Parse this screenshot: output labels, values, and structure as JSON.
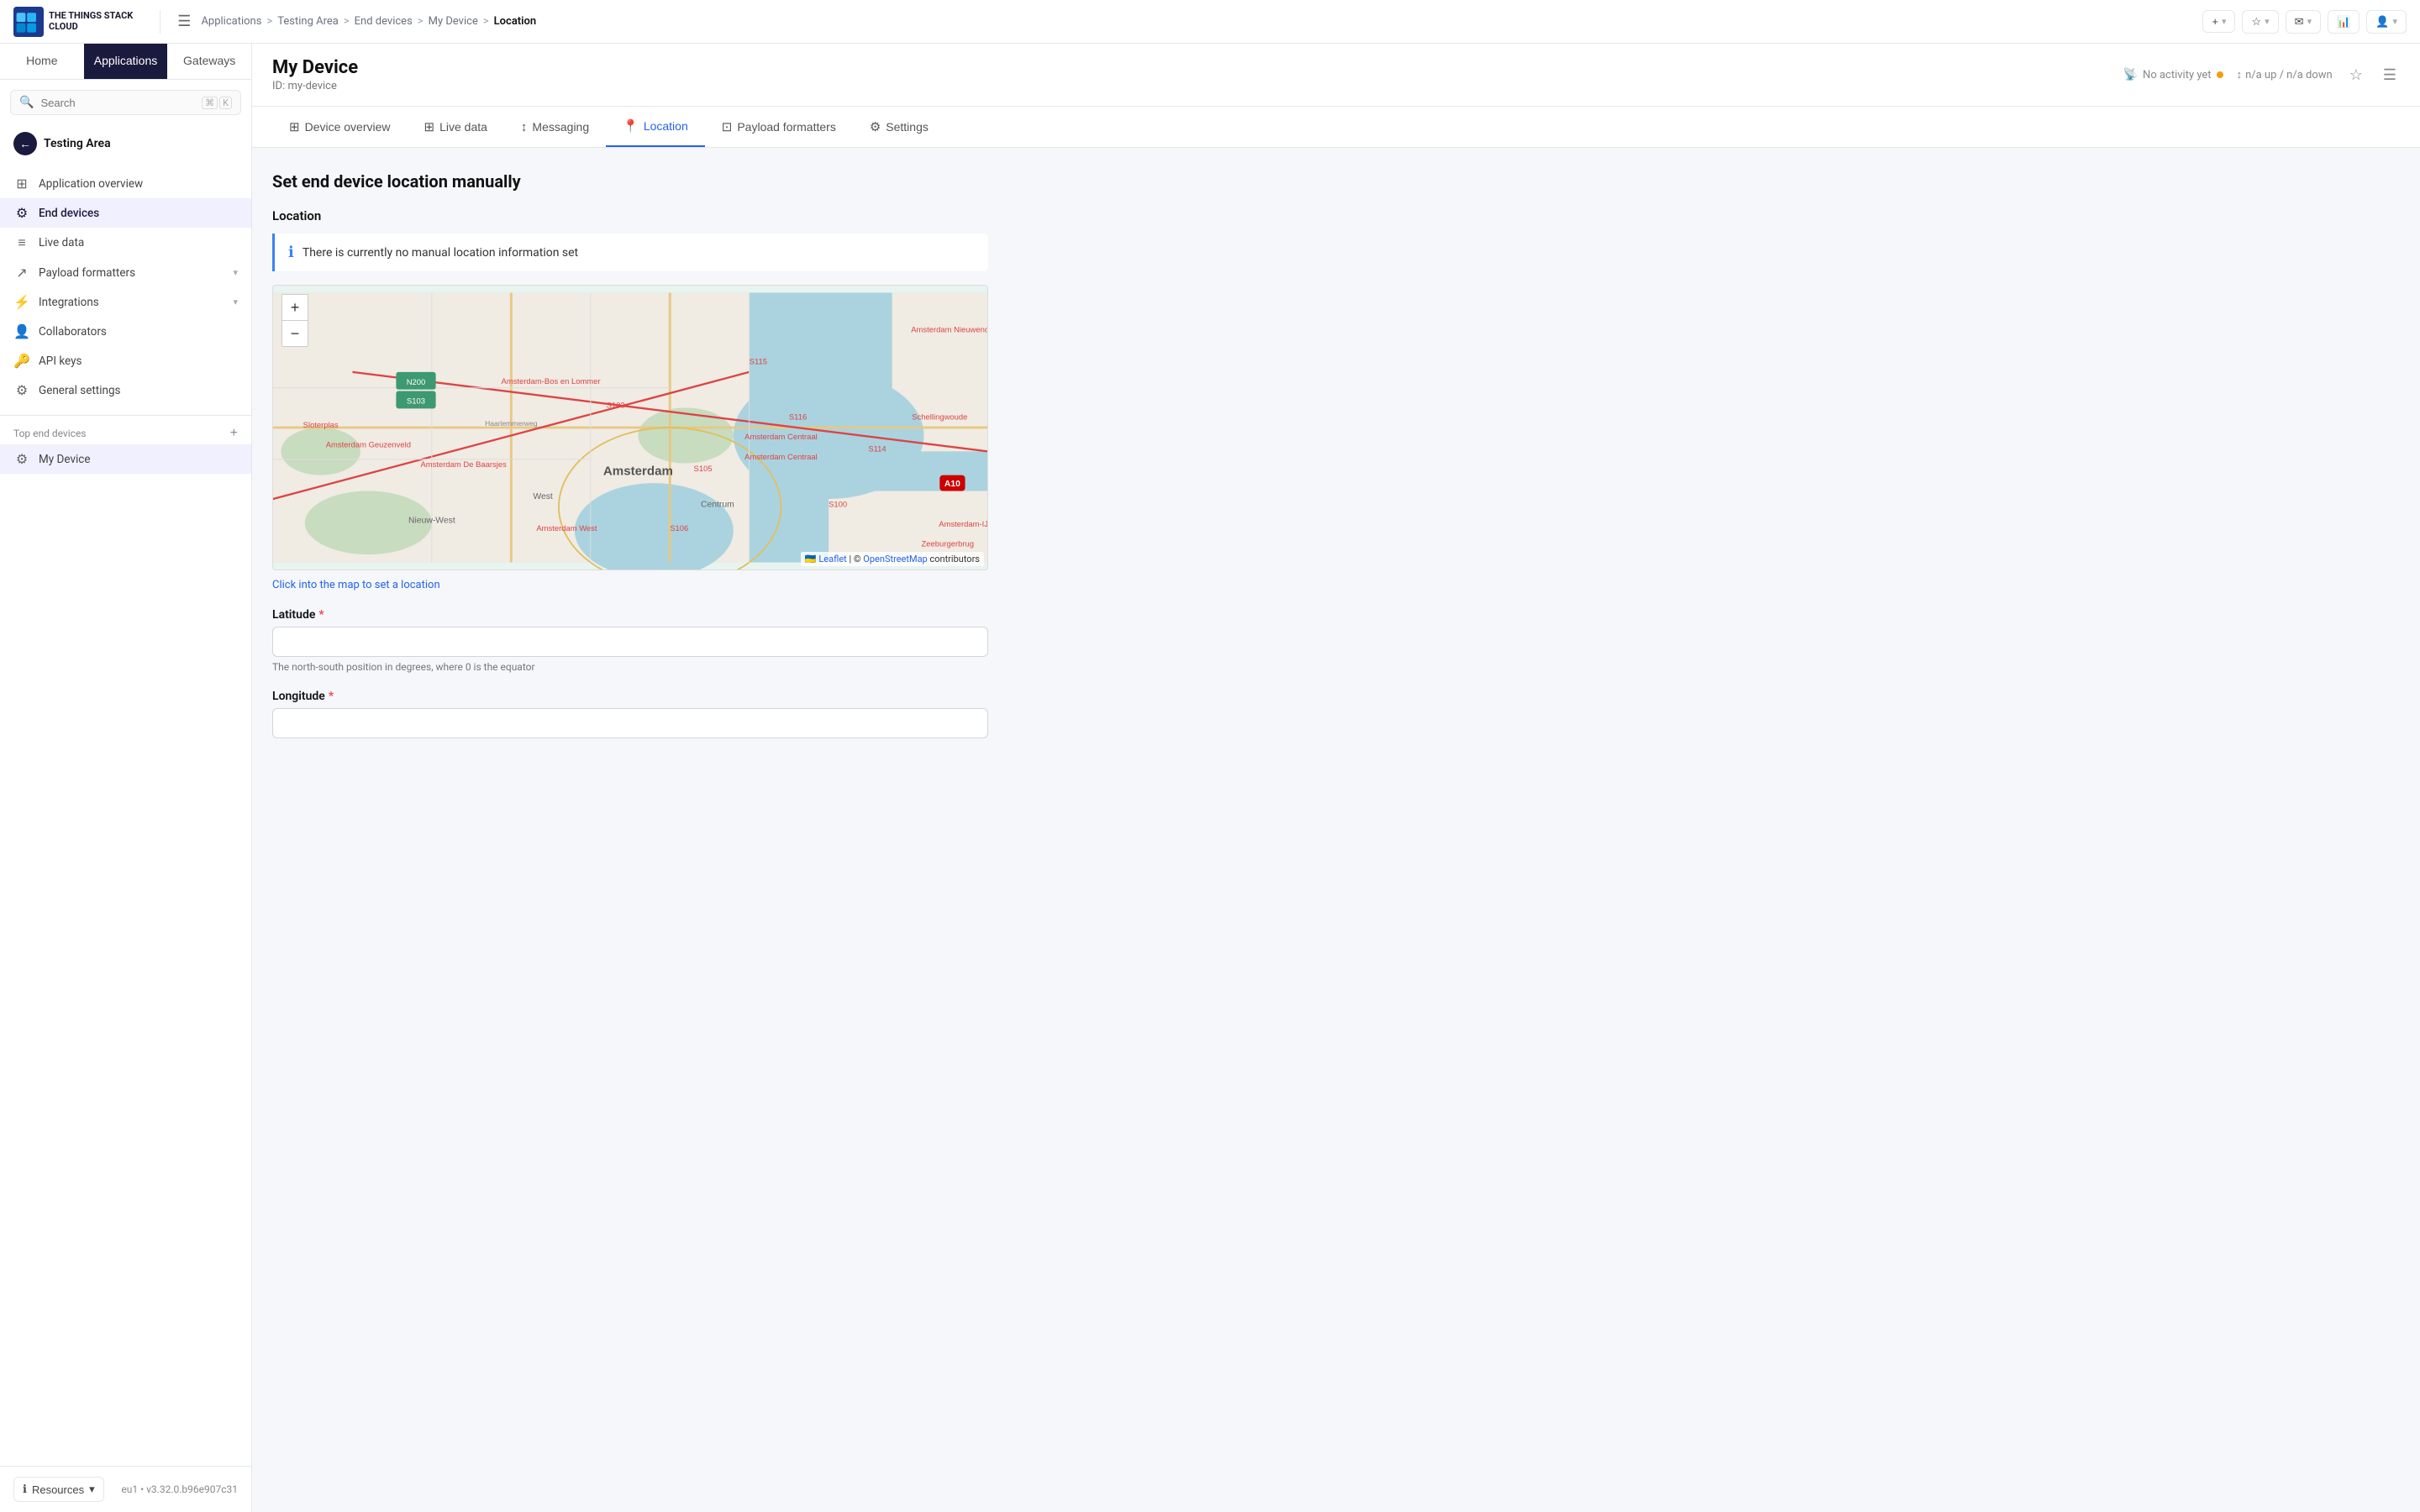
{
  "logo": {
    "text_line1": "THE THINGS STACK",
    "text_line2": "CLOUD"
  },
  "breadcrumb": {
    "items": [
      {
        "label": "Applications",
        "href": "#"
      },
      {
        "label": "Testing Area",
        "href": "#"
      },
      {
        "label": "End devices",
        "href": "#"
      },
      {
        "label": "My Device",
        "href": "#"
      },
      {
        "label": "Location"
      }
    ],
    "separator": ">"
  },
  "topbar": {
    "add_label": "+",
    "bookmark_label": "★",
    "notification_label": "✉",
    "stats_label": "📊"
  },
  "sidebar": {
    "nav_tabs": [
      {
        "label": "Home"
      },
      {
        "label": "Applications",
        "active": true
      },
      {
        "label": "Gateways"
      }
    ],
    "search_placeholder": "Search",
    "search_shortcut_1": "⌘",
    "search_shortcut_2": "K",
    "section": {
      "title": "Testing Area"
    },
    "menu_items": [
      {
        "label": "Application overview",
        "icon": "⊞"
      },
      {
        "label": "End devices",
        "icon": "⚙",
        "active": true
      },
      {
        "label": "Live data",
        "icon": "≡"
      },
      {
        "label": "Payload formatters",
        "icon": "↗",
        "has_chevron": true
      },
      {
        "label": "Integrations",
        "icon": "⚡",
        "has_chevron": true
      },
      {
        "label": "Collaborators",
        "icon": "👤"
      },
      {
        "label": "API keys",
        "icon": "🔑"
      },
      {
        "label": "General settings",
        "icon": "⚙"
      }
    ],
    "sub_section_label": "Top end devices",
    "device_item": {
      "label": "My Device",
      "icon": "⚙"
    },
    "bottom": {
      "resources_label": "Resources",
      "version": "eu1 • v3.32.0.b96e907c31"
    }
  },
  "device": {
    "title": "My Device",
    "id_label": "ID: my-device",
    "activity": "No activity yet",
    "updown": "n/a up / n/a down"
  },
  "tabs": [
    {
      "label": "Device overview",
      "icon": "⊞"
    },
    {
      "label": "Live data",
      "icon": "⊞"
    },
    {
      "label": "Messaging",
      "icon": "↕"
    },
    {
      "label": "Location",
      "icon": "📍",
      "active": true
    },
    {
      "label": "Payload formatters",
      "icon": "⊡"
    },
    {
      "label": "Settings",
      "icon": "⚙"
    }
  ],
  "page": {
    "title": "Set end device location manually",
    "location_section": "Location",
    "notice": "There is currently no manual location information set",
    "map_hint": "Click into the map to set a location",
    "latitude_label": "Latitude",
    "latitude_hint": "The north-south position in degrees, where 0 is the equator",
    "longitude_label": "Longitude",
    "map_credit_leaflet": "Leaflet",
    "map_credit_osm": "OpenStreetMap",
    "map_credit_suffix": "contributors"
  }
}
